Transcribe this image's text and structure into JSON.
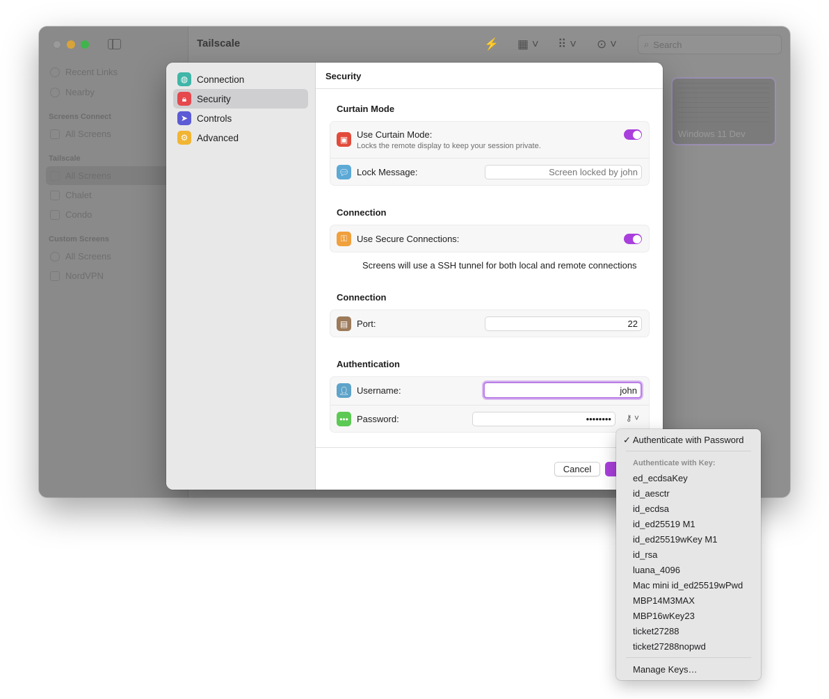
{
  "window": {
    "title": "Tailscale",
    "search_placeholder": "Search",
    "sidebar": {
      "items_top": [
        {
          "label": "Recent Links"
        },
        {
          "label": "Nearby"
        }
      ],
      "sections": [
        {
          "heading": "Screens Connect",
          "items": [
            {
              "label": "All Screens"
            }
          ]
        },
        {
          "heading": "Tailscale",
          "items": [
            {
              "label": "All Screens"
            },
            {
              "label": "Chalet"
            },
            {
              "label": "Condo"
            }
          ]
        },
        {
          "heading": "Custom Screens",
          "items": [
            {
              "label": "All Screens"
            },
            {
              "label": "NordVPN"
            }
          ]
        }
      ]
    },
    "thumbnail": {
      "label": "Windows 11 Dev"
    }
  },
  "dialog": {
    "nav": [
      {
        "label": "Connection",
        "icon": "globe-icon",
        "color": "#3fb6a8"
      },
      {
        "label": "Security",
        "icon": "lock-icon",
        "color": "#e5484d"
      },
      {
        "label": "Controls",
        "icon": "cursor-icon",
        "color": "#5b5bd6"
      },
      {
        "label": "Advanced",
        "icon": "gears-icon",
        "color": "#f1b533"
      }
    ],
    "header": "Security",
    "curtain": {
      "section": "Curtain Mode",
      "use_label": "Use Curtain Mode:",
      "use_sub": "Locks the remote display to keep your session private.",
      "lock_label": "Lock Message:",
      "lock_placeholder": "Screen locked by john"
    },
    "secure": {
      "section": "Connection",
      "label": "Use Secure Connections:",
      "note": "Screens will use a SSH tunnel for both local and remote connections"
    },
    "port": {
      "section": "Connection",
      "label": "Port:",
      "value": "22"
    },
    "auth": {
      "section": "Authentication",
      "username_label": "Username:",
      "username_value": "john",
      "password_label": "Password:",
      "password_value": "••••••••"
    },
    "buttons": {
      "cancel": "Cancel"
    }
  },
  "menu": {
    "checked_item": "Authenticate with Password",
    "key_heading": "Authenticate with Key:",
    "keys": [
      "ed_ecdsaKey",
      "id_aesctr",
      "id_ecdsa",
      "id_ed25519 M1",
      "id_ed25519wKey M1",
      "id_rsa",
      "luana_4096",
      "Mac mini id_ed25519wPwd",
      "MBP14M3MAX",
      "MBP16wKey23",
      "ticket27288",
      "ticket27288nopwd"
    ],
    "manage": "Manage Keys…"
  }
}
